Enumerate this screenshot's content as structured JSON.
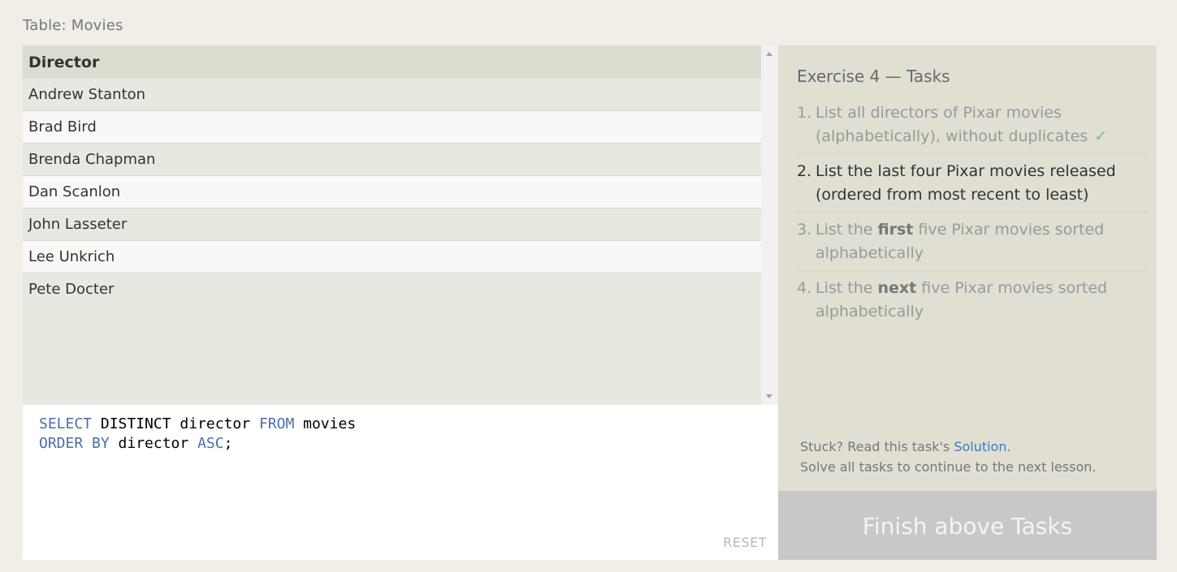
{
  "table_title": "Table: Movies",
  "result": {
    "column_header": "Director",
    "rows": [
      "Andrew Stanton",
      "Brad Bird",
      "Brenda Chapman",
      "Dan Scanlon",
      "John Lasseter",
      "Lee Unkrich",
      "Pete Docter"
    ]
  },
  "editor": {
    "line1": {
      "kw1": "SELECT",
      "t1": " DISTINCT director ",
      "kw2": "FROM",
      "t2": " movies"
    },
    "line2": {
      "kw1": "ORDER BY",
      "t1": " director ",
      "kw2": "ASC",
      "t2": ";"
    },
    "reset_label": "RESET"
  },
  "exercise": {
    "heading": "Exercise 4 — Tasks",
    "tasks": [
      {
        "num": "1.",
        "text": "List all directors of Pixar movies (alphabetically), without duplicates",
        "check": "✓"
      },
      {
        "num": "2.",
        "text": "List the last four Pixar movies released (ordered from most recent to least)"
      },
      {
        "num": "3.",
        "pre": "List the ",
        "bold": "first",
        "post": " five Pixar movies sorted alphabetically"
      },
      {
        "num": "4.",
        "pre": "List the ",
        "bold": "next",
        "post": " five Pixar movies sorted alphabetically"
      }
    ],
    "stuck_prefix": "Stuck? Read this task's ",
    "solution_link": "Solution",
    "stuck_suffix": ".",
    "continue_text": "Solve all tasks to continue to the next lesson.",
    "finish_label": "Finish above Tasks"
  },
  "colors": {
    "keyword": "#4a6ea9",
    "check": "#7cc07c",
    "link": "#3f7bc4",
    "finish_bg": "#c8c8c8"
  }
}
